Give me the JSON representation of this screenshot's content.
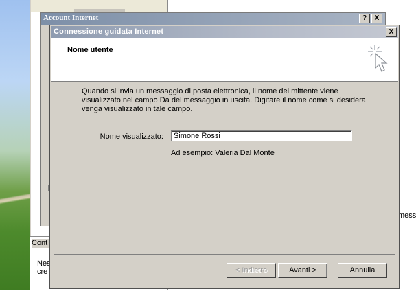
{
  "background": {
    "account_window_title": "Account Internet",
    "account_window_controls": [
      "?",
      "X"
    ],
    "right_panel_text": "messa",
    "bottom_tab_text": "Cont",
    "bottom_text_line1": "Nes",
    "bottom_text_line2": "cre"
  },
  "wizard": {
    "title": "Connessione guidata Internet",
    "close_label": "X",
    "header_title": "Nome utente",
    "header_icon": "wizard-wand-icon",
    "description": "Quando si invia un messaggio di posta elettronica, il nome del mittente viene visualizzato nel campo Da del messaggio in uscita. Digitare il nome come si desidera venga visualizzato in tale campo.",
    "display_name_label": "Nome visualizzato:",
    "display_name_value": "Simone Rossi",
    "example_text": "Ad esempio: Valeria Dal Monte",
    "buttons": {
      "back": "< Indietro",
      "next": "Avanti >",
      "cancel": "Annulla"
    }
  },
  "colors": {
    "dialog_face": "#d4d0c8",
    "inactive_title_start": "#8e9bb0",
    "inactive_title_end": "#c4c8d2"
  }
}
